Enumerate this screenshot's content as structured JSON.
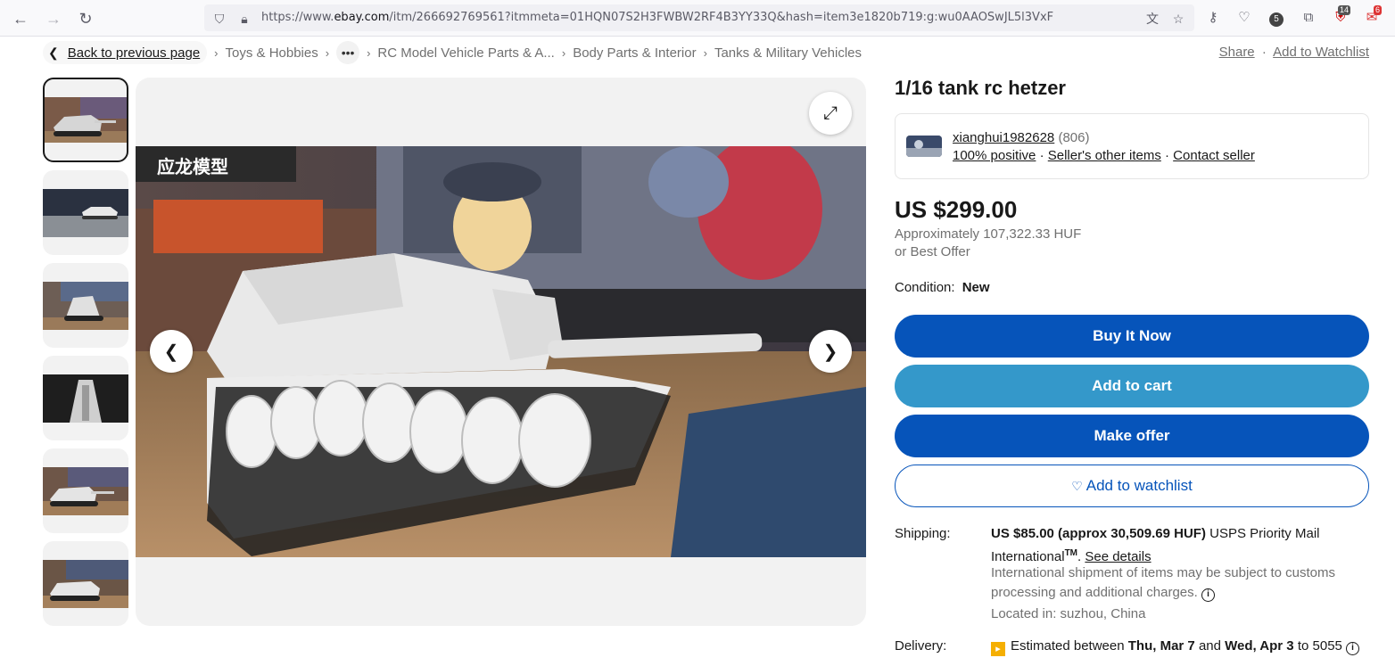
{
  "browser": {
    "url_prefix": "https://www.",
    "url_domain": "ebay.com",
    "url_rest": "/itm/266692769561?itmmeta=01HQN07S2H3FWBW2RF4B3YY33Q&hash=item3e1820b719:g:wu0AAOSwJL5l3VxF",
    "ext_badge_1": "5",
    "ext_badge_2": "14",
    "ext_badge_3": "6"
  },
  "breadcrumb": {
    "back": "Back to previous page",
    "items": [
      "Toys & Hobbies",
      "RC Model Vehicle Parts & A...",
      "Body Parts & Interior",
      "Tanks & Military Vehicles"
    ]
  },
  "top_actions": {
    "share": "Share",
    "watchlist": "Add to Watchlist"
  },
  "image_overlay_text": "应龙模型",
  "listing": {
    "title": "1/16 tank rc hetzer",
    "seller_name": "xianghui1982628",
    "seller_count": "(806)",
    "positive": "100% positive",
    "other_items": "Seller's other items",
    "contact": "Contact seller",
    "price": "US $299.00",
    "approx_label": "Approximately",
    "approx_value": "107,322.33 HUF",
    "best_offer": "or Best Offer",
    "condition_label": "Condition:",
    "condition_value": "New",
    "buy_now": "Buy It Now",
    "add_cart": "Add to cart",
    "make_offer": "Make offer",
    "add_watchlist": "Add to watchlist"
  },
  "shipping": {
    "label": "Shipping:",
    "cost": "US $85.00 (approx 30,509.69 HUF)",
    "method": "USPS Priority Mail International",
    "tm": "TM",
    "see_details": "See details",
    "note": "International shipment of items may be subject to customs processing and additional charges.",
    "located": "Located in: suzhou, China"
  },
  "delivery": {
    "label": "Delivery:",
    "text_pre": "Estimated between",
    "date1": "Thu, Mar 7",
    "and": "and",
    "date2": "Wed, Apr 3",
    "to": "to 5055"
  },
  "colors": {
    "primary_blue": "#0654ba",
    "light_blue": "#3498ca",
    "gray_bg": "#f2f2f2"
  }
}
